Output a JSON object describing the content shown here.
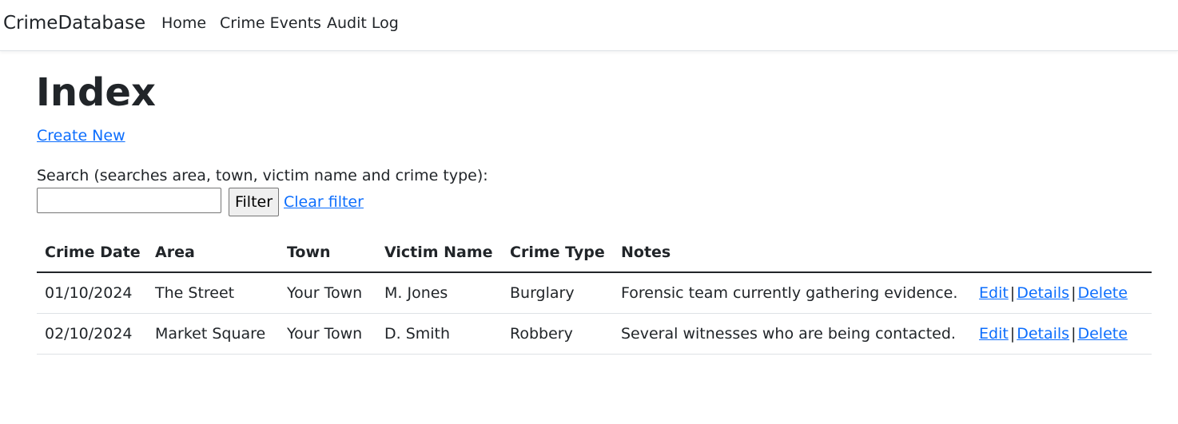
{
  "navbar": {
    "brand": "CrimeDatabase",
    "links": [
      "Home",
      "Crime Events",
      "Audit Log"
    ]
  },
  "page": {
    "title": "Index",
    "create_new": "Create New"
  },
  "search": {
    "label": "Search (searches area, town, victim name and crime type):",
    "value": "",
    "filter_button": "Filter",
    "clear_filter": "Clear filter"
  },
  "table": {
    "headers": [
      "Crime Date",
      "Area",
      "Town",
      "Victim Name",
      "Crime Type",
      "Notes"
    ],
    "rows": [
      {
        "crime_date": "01/10/2024",
        "area": "The Street",
        "town": "Your Town",
        "victim_name": "M. Jones",
        "crime_type": "Burglary",
        "notes": "Forensic team currently gathering evidence."
      },
      {
        "crime_date": "02/10/2024",
        "area": "Market Square",
        "town": "Your Town",
        "victim_name": "D. Smith",
        "crime_type": "Robbery",
        "notes": "Several witnesses who are being contacted."
      }
    ],
    "actions": {
      "edit": "Edit",
      "details": "Details",
      "delete": "Delete",
      "separator": "|"
    }
  },
  "colors": {
    "link": "#0d6efd",
    "text": "#212529",
    "border": "#dee2e6"
  }
}
